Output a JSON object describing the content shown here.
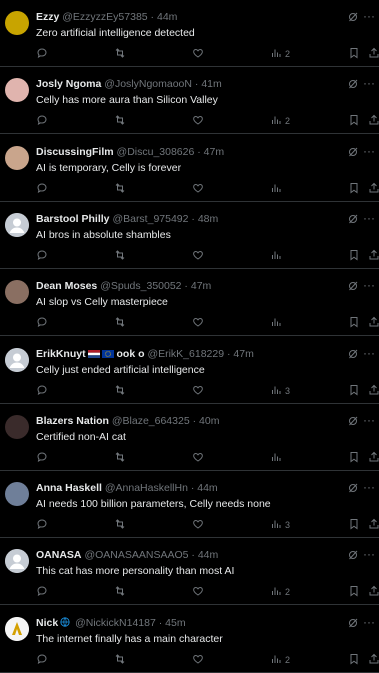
{
  "colors": {
    "background": "#000000",
    "text": "#e7e9ea",
    "muted": "#71767b",
    "divider": "#2f3336",
    "verified_blue": "#1d9bf0"
  },
  "tweets": [
    {
      "name": "Ezzy",
      "handle": "@EzzyzzEy57385",
      "time": "44m",
      "text": "Zero artificial intelligence detected",
      "views": "2",
      "avatar_color": "#c8a400"
    },
    {
      "name": "Josly Ngoma",
      "handle": "@JoslyNgomaooN",
      "time": "41m",
      "text": "Celly has more aura than Silicon Valley",
      "views": "2",
      "avatar_color": "#e0b4ae"
    },
    {
      "name": "DiscussingFilm",
      "handle": "@Discu_308626",
      "time": "47m",
      "text": "AI is temporary, Celly is forever",
      "views": "",
      "avatar_color": "#c9a58c"
    },
    {
      "name": "Barstool Philly",
      "handle": "@Barst_975492",
      "time": "48m",
      "text": "AI bros in absolute shambles",
      "views": "",
      "avatar_color": "#c6ccd4"
    },
    {
      "name": "Dean Moses",
      "handle": "@Spuds_350052",
      "time": "47m",
      "text": "AI slop vs Celly masterpiece",
      "views": "",
      "avatar_color": "#8a6f62"
    },
    {
      "name": "ErikKnuyt",
      "suffix": "ook o",
      "handle": "@ErikK_618229",
      "time": "47m",
      "text": "Celly just ended artificial intelligence",
      "views": "3",
      "avatar_color": "#c6ccd4"
    },
    {
      "name": "Blazers Nation",
      "handle": "@Blaze_664325",
      "time": "40m",
      "text": "Certified non-AI cat",
      "views": "",
      "avatar_color": "#3a2b2b"
    },
    {
      "name": "Anna Haskell",
      "handle": "@AnnaHaskellHn",
      "time": "44m",
      "text": "AI needs 100 billion parameters, Celly needs none",
      "views": "3",
      "avatar_color": "#6f7f99"
    },
    {
      "name": "OANASA",
      "handle": "@OANASAANSAAO5",
      "time": "44m",
      "text": "This cat has more personality than most AI",
      "views": "2",
      "avatar_color": "#c6ccd4"
    },
    {
      "name": "Nick",
      "handle": "@NickickN14187",
      "time": "45m",
      "text": "The internet finally has a main character",
      "views": "2",
      "avatar_color": "#f5f5f5"
    }
  ],
  "separator": "·",
  "more_glyph": "···"
}
